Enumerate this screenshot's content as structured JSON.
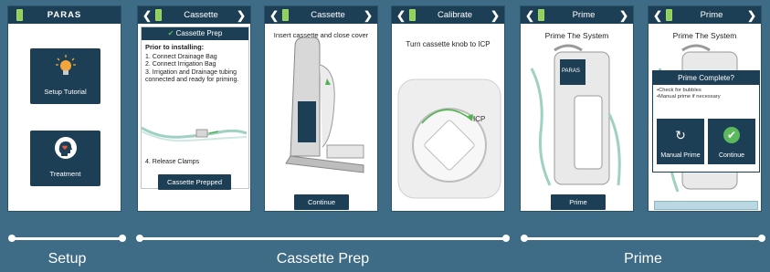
{
  "colors": {
    "background": "#3e6b85",
    "bar": "#1d3f55",
    "accent": "#5cb85c"
  },
  "screen1": {
    "logo": "PARAS",
    "tile1_label": "Setup Tutorial",
    "tile1_icon": "lightbulb-icon",
    "tile2_label": "Treatment",
    "tile2_icon": "head-heart-icon"
  },
  "screen2": {
    "title": "Cassette",
    "card_title": "Cassette Prep",
    "heading": "Prior to installing:",
    "steps": [
      "1. Connect Drainage Bag",
      "2. Connect Irrigation Bag",
      "3. Irrigation and Drainage tubing connected and ready for priming."
    ],
    "step4": "4. Release Clamps",
    "button": "Cassette Prepped"
  },
  "screen3": {
    "title": "Cassette",
    "instruction": "Insert cassette and close cover",
    "button": "Continue"
  },
  "screen4": {
    "title": "Calibrate",
    "instruction": "Turn cassette knob to ICP",
    "knob_label": "ICP"
  },
  "screen5": {
    "title": "Prime",
    "heading": "Prime The System",
    "device_logo": "PARAS",
    "button": "Prime"
  },
  "screen6": {
    "title": "Prime",
    "heading": "Prime The System",
    "modal_title": "Prime Complete?",
    "bullets": [
      "•Check for bubbles",
      "•Manual prime if necessary"
    ],
    "manual_button": "Manual Prime",
    "continue_button": "Continue"
  },
  "timeline": {
    "labels": [
      "Setup",
      "Cassette Prep",
      "Prime"
    ]
  }
}
